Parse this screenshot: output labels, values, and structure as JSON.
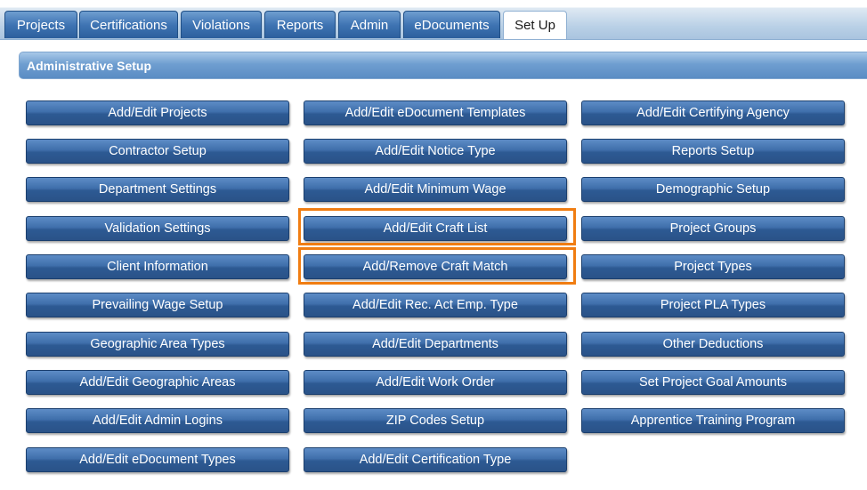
{
  "tabs": [
    {
      "label": "Projects",
      "active": false
    },
    {
      "label": "Certifications",
      "active": false
    },
    {
      "label": "Violations",
      "active": false
    },
    {
      "label": "Reports",
      "active": false
    },
    {
      "label": "Admin",
      "active": false
    },
    {
      "label": "eDocuments",
      "active": false
    },
    {
      "label": "Set Up",
      "active": true
    }
  ],
  "section": {
    "title": "Administrative Setup"
  },
  "buttons": {
    "col1": [
      "Add/Edit Projects",
      "Contractor Setup",
      "Department Settings",
      "Validation Settings",
      "Client Information",
      "Prevailing Wage Setup",
      "Geographic Area Types",
      "Add/Edit Geographic Areas",
      "Add/Edit Admin Logins",
      "Add/Edit eDocument Types"
    ],
    "col2": [
      "Add/Edit eDocument Templates",
      "Add/Edit Notice Type",
      "Add/Edit Minimum Wage",
      "Add/Edit Craft List",
      "Add/Remove Craft Match",
      "Add/Edit Rec. Act Emp. Type",
      "Add/Edit Departments",
      "Add/Edit Work Order",
      "ZIP Codes Setup",
      "Add/Edit Certification Type"
    ],
    "col3": [
      "Add/Edit Certifying Agency",
      "Reports Setup",
      "Demographic Setup",
      "Project Groups",
      "Project Types",
      "Project PLA Types",
      "Other Deductions",
      "Set Project Goal Amounts",
      "Apprentice Training Program"
    ]
  },
  "highlighted": [
    "Add/Edit Craft List",
    "Add/Remove Craft Match"
  ],
  "colors": {
    "tab_active_bg": "#ffffff",
    "button_bg": "#3f6fab",
    "header_bg": "#6f9ed0",
    "highlight": "#f07d12"
  }
}
